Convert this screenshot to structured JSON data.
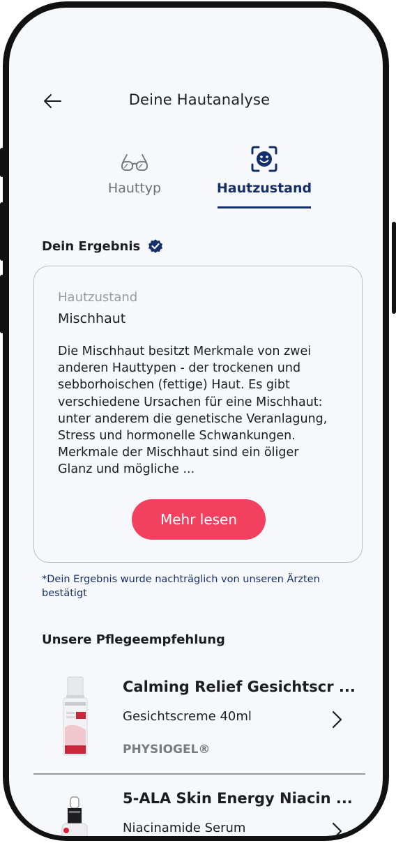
{
  "header": {
    "title": "Deine Hautanalyse"
  },
  "tabs": [
    {
      "label": "Hauttyp",
      "icon": "glasses-icon",
      "active": false
    },
    {
      "label": "Hautzustand",
      "icon": "face-scan-icon",
      "active": true
    }
  ],
  "result": {
    "section_title": "Dein Ergebnis",
    "label": "Hautzustand",
    "value": "Mischhaut",
    "description": "Die Mischhaut besitzt Merkmale von zwei anderen Hauttypen - der trockenen und sebborhoischen (fettige) Haut. Es gibt verschiedene Ursachen für eine Mischhaut: unter anderem die genetische Veranlagung, Stress und hormonelle Schwankungen. Merkmale der Mischhaut sind ein öliger Glanz und mögliche ...",
    "more_button": "Mehr lesen",
    "footnote": "*Dein Ergebnis wurde nachträglich von unseren Ärzten bestätigt"
  },
  "recommendations": {
    "section_title": "Unsere Pflegeempfehlung",
    "items": [
      {
        "name": "Calming Relief Gesichtscr ...",
        "subtitle": "Gesichtscreme 40ml",
        "brand": "PHYSIOGEL®"
      },
      {
        "name": "5-ALA Skin Energy Niacin ...",
        "subtitle": "Niacinamide Serum"
      }
    ]
  },
  "colors": {
    "accent": "#f2405f",
    "navy": "#14306b",
    "background": "#f6f8fb"
  }
}
